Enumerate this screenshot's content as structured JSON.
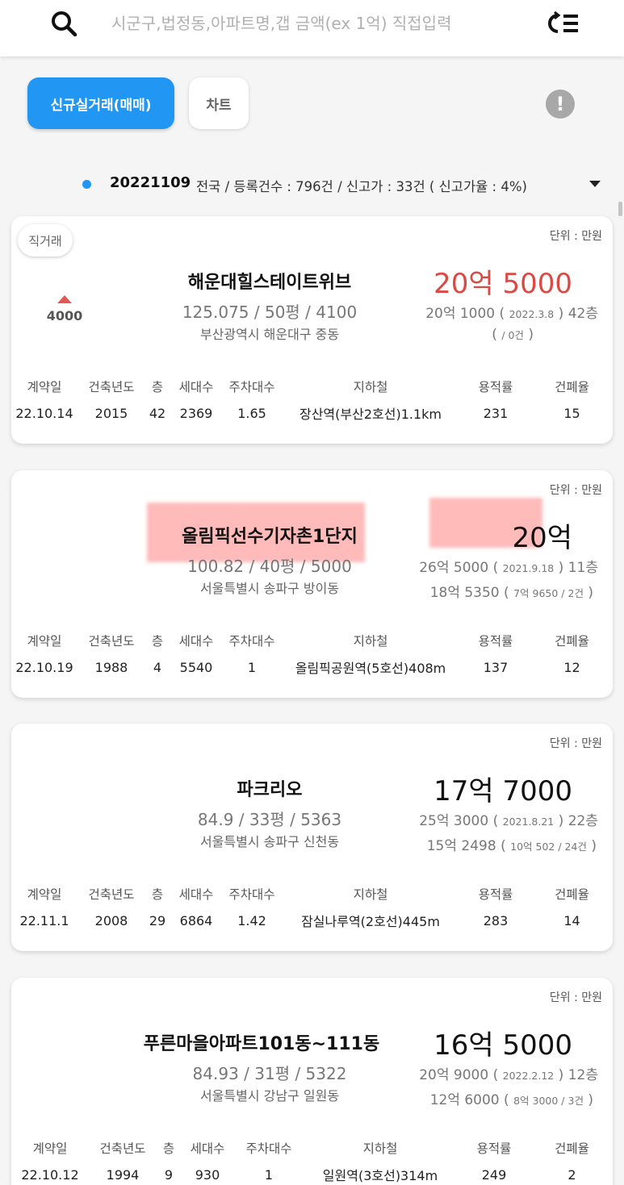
{
  "search": {
    "placeholder": "시군구,법정동,아파트명,갭 금액(ex 1억) 직접입력",
    "icon": "search-icon",
    "filter_icon": "filter-list-icon"
  },
  "toolbar": {
    "primary_tab": "신규실거래(매매)",
    "chart_tab": "차트",
    "info_icon": "!"
  },
  "summary": {
    "date": "20221109",
    "text": "전국 / 등록건수 : 796건 / 신고가 : 33건 ( 신고가율 : 4%)"
  },
  "colors": {
    "accent": "#2196f3",
    "up": "#d94a44",
    "highlight": "#ff8a8a"
  },
  "columns": [
    "계약일",
    "건축년도",
    "층",
    "세대수",
    "주차대수",
    "지하철",
    "용적률",
    "건폐율"
  ],
  "cards": [
    {
      "unit": "단위 : 만원",
      "badge": "직거래",
      "delta": "4000",
      "name": "해운대힐스테이트위브",
      "spec": "125.075 / 50평 / 4100",
      "addr": "부산광역시 해운대구 중동",
      "price": "20억 5000",
      "hist1_price": "20억 1000",
      "hist1_date": "2022.3.8",
      "hist1_floor": "42층",
      "hist2_price": "",
      "hist2_detail": "/ 0건",
      "row": [
        "22.10.14",
        "2015",
        "42",
        "2369",
        "1.65",
        "장산역(부산2호선)1.1km",
        "231",
        "15"
      ]
    },
    {
      "unit": "단위 : 만원",
      "name": "올림픽선수기자촌1단지",
      "spec": "100.82 / 40평 / 5000",
      "addr": "서울특별시 송파구 방이동",
      "price": "20억",
      "hist1_price": "26억 5000",
      "hist1_date": "2021.9.18",
      "hist1_floor": "11층",
      "hist2_price": "18억 5350",
      "hist2_detail": "7억 9650 / 2건",
      "row": [
        "22.10.19",
        "1988",
        "4",
        "5540",
        "1",
        "올림픽공원역(5호선)408m",
        "137",
        "12"
      ]
    },
    {
      "unit": "단위 : 만원",
      "name": "파크리오",
      "spec": "84.9 / 33평 / 5363",
      "addr": "서울특별시 송파구 신천동",
      "price": "17억 7000",
      "hist1_price": "25억 3000",
      "hist1_date": "2021.8.21",
      "hist1_floor": "22층",
      "hist2_price": "15억 2498",
      "hist2_detail": "10억 502 / 24건",
      "row": [
        "22.11.1",
        "2008",
        "29",
        "6864",
        "1.42",
        "잠실나루역(2호선)445m",
        "283",
        "14"
      ]
    },
    {
      "unit": "단위 : 만원",
      "name": "푸른마을아파트101동~111동",
      "spec": "84.93 / 31평 / 5322",
      "addr": "서울특별시 강남구 일원동",
      "price": "16억 5000",
      "hist1_price": "20억 9000",
      "hist1_date": "2022.2.12",
      "hist1_floor": "12층",
      "hist2_price": "12억 6000",
      "hist2_detail": "8억 3000 / 3건",
      "row": [
        "22.10.12",
        "1994",
        "9",
        "930",
        "1",
        "일원역(3호선)314m",
        "249",
        "2"
      ]
    }
  ]
}
